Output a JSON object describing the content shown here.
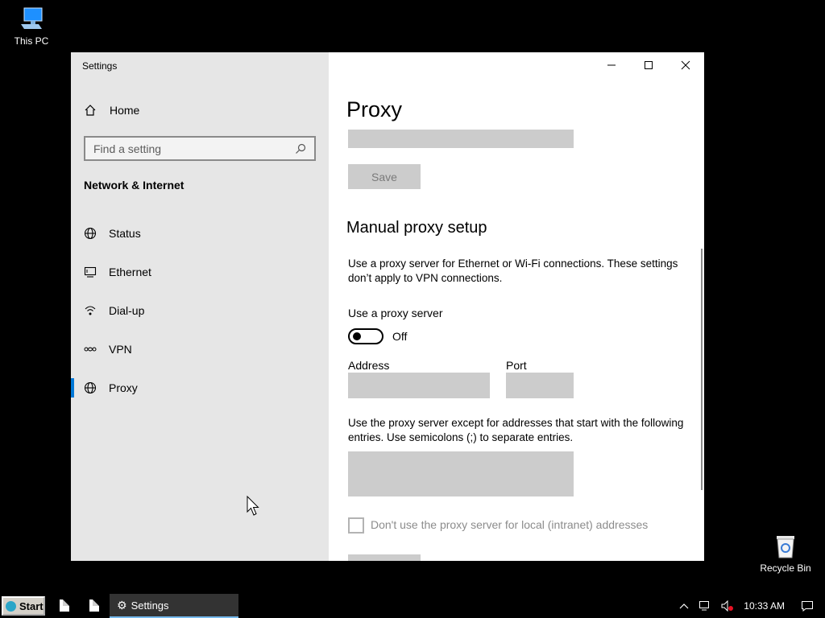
{
  "desktop": {
    "this_pc": "This PC",
    "recycle_bin": "Recycle Bin"
  },
  "window": {
    "title": "Settings"
  },
  "sidebar": {
    "home": "Home",
    "search_placeholder": "Find a setting",
    "section": "Network & Internet",
    "items": [
      {
        "label": "Status",
        "icon": "globe-icon"
      },
      {
        "label": "Ethernet",
        "icon": "ethernet-icon"
      },
      {
        "label": "Dial-up",
        "icon": "dialup-icon"
      },
      {
        "label": "VPN",
        "icon": "vpn-icon"
      },
      {
        "label": "Proxy",
        "icon": "globe-icon",
        "active": true
      }
    ]
  },
  "content": {
    "page_title": "Proxy",
    "save_label": "Save",
    "manual_heading": "Manual proxy setup",
    "manual_desc": "Use a proxy server for Ethernet or Wi-Fi connections. These settings don’t apply to VPN connections.",
    "use_proxy_label": "Use a proxy server",
    "toggle_state": "Off",
    "address_label": "Address",
    "port_label": "Port",
    "exceptions_desc": "Use the proxy server except for addresses that start with the following entries. Use semicolons (;) to separate entries.",
    "local_checkbox_label": "Don't use the proxy server for local (intranet) addresses"
  },
  "taskbar": {
    "start": "Start",
    "active_app": "Settings",
    "time": "10:33 AM"
  },
  "colors": {
    "accent": "#0078d7",
    "sidebar_bg": "#e6e6e6",
    "disabled_field": "#cccccc"
  }
}
